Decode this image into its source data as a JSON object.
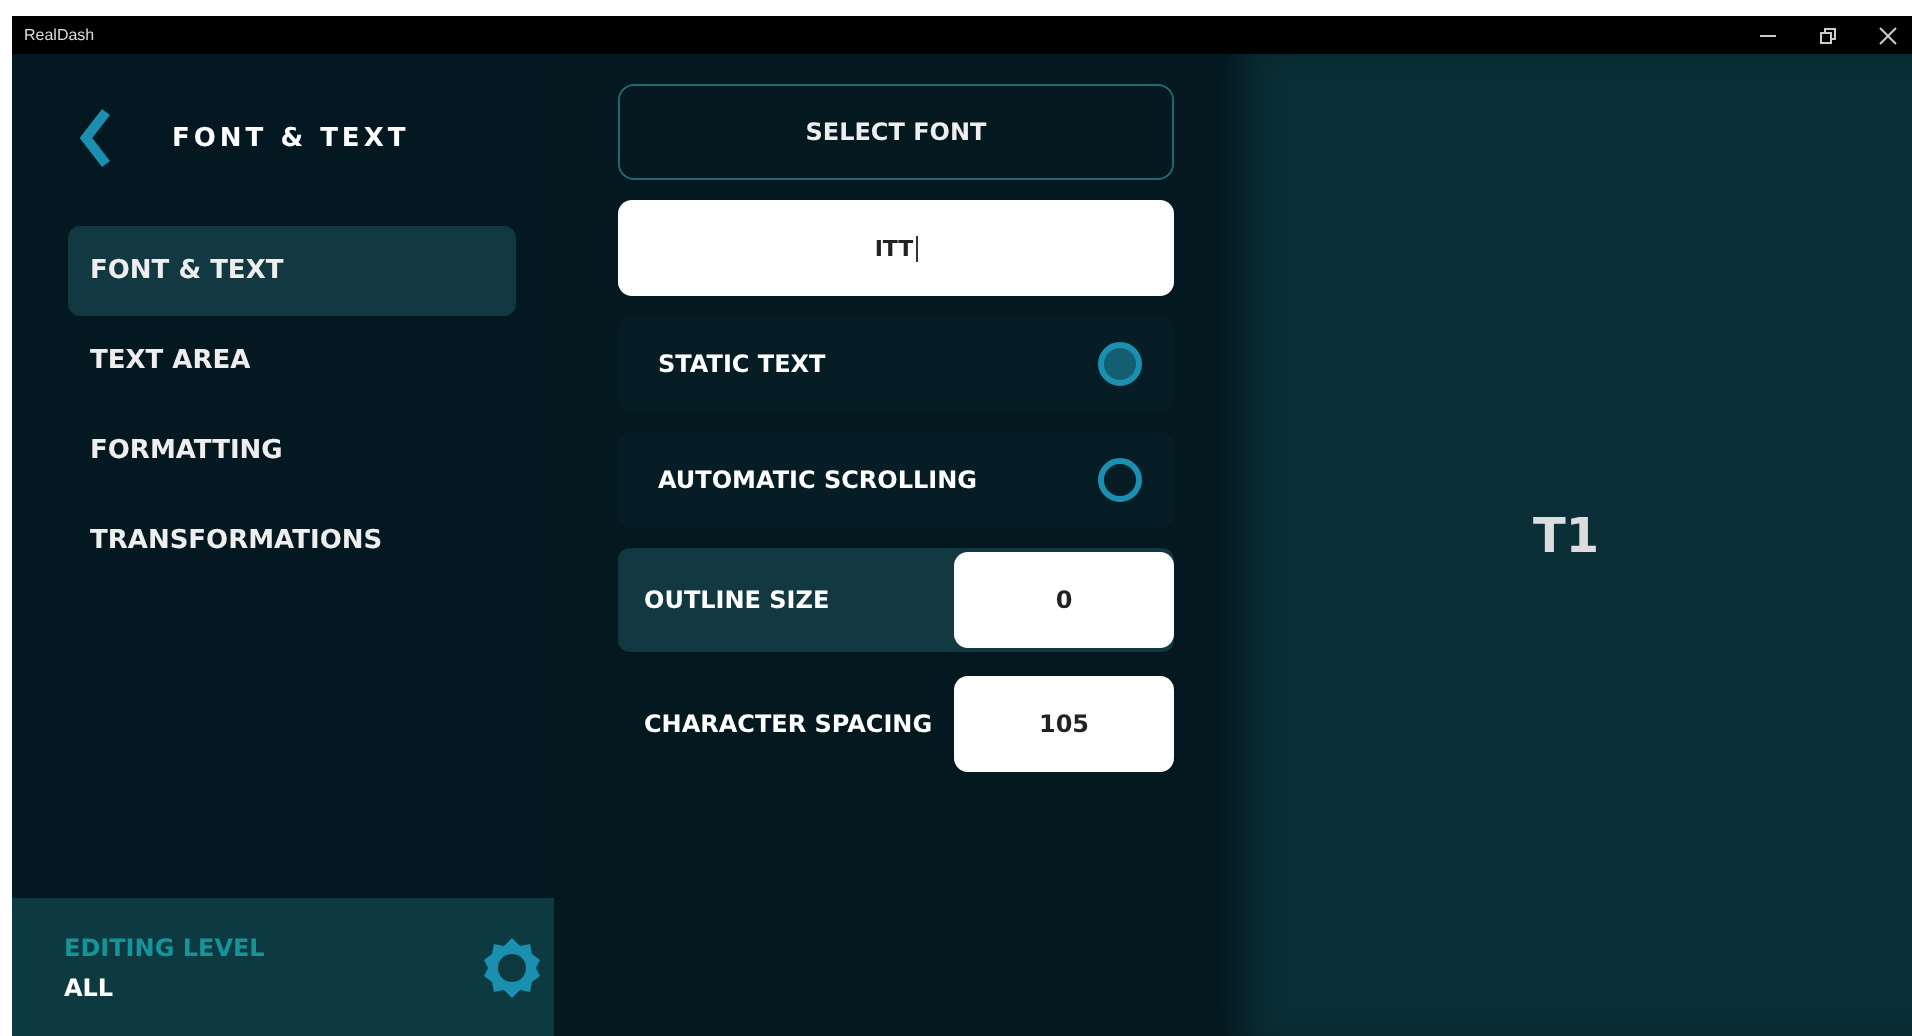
{
  "window": {
    "title": "RealDash"
  },
  "sidebar": {
    "title": "FONT & TEXT",
    "items": [
      {
        "label": "FONT & TEXT",
        "selected": true
      },
      {
        "label": "TEXT AREA",
        "selected": false
      },
      {
        "label": "FORMATTING",
        "selected": false
      },
      {
        "label": "TRANSFORMATIONS",
        "selected": false
      }
    ],
    "footer": {
      "label": "EDITING LEVEL",
      "value": "ALL"
    }
  },
  "editor": {
    "select_button": "SELECT FONT",
    "text_value": "ITT",
    "options": [
      {
        "label": "STATIC TEXT",
        "selected": true
      },
      {
        "label": "AUTOMATIC SCROLLING",
        "selected": false
      }
    ],
    "numbers": [
      {
        "label": "OUTLINE SIZE",
        "value": "0",
        "selected": true
      },
      {
        "label": "CHARACTER SPACING",
        "value": "105",
        "selected": false
      }
    ]
  },
  "preview": {
    "text": "T1"
  }
}
